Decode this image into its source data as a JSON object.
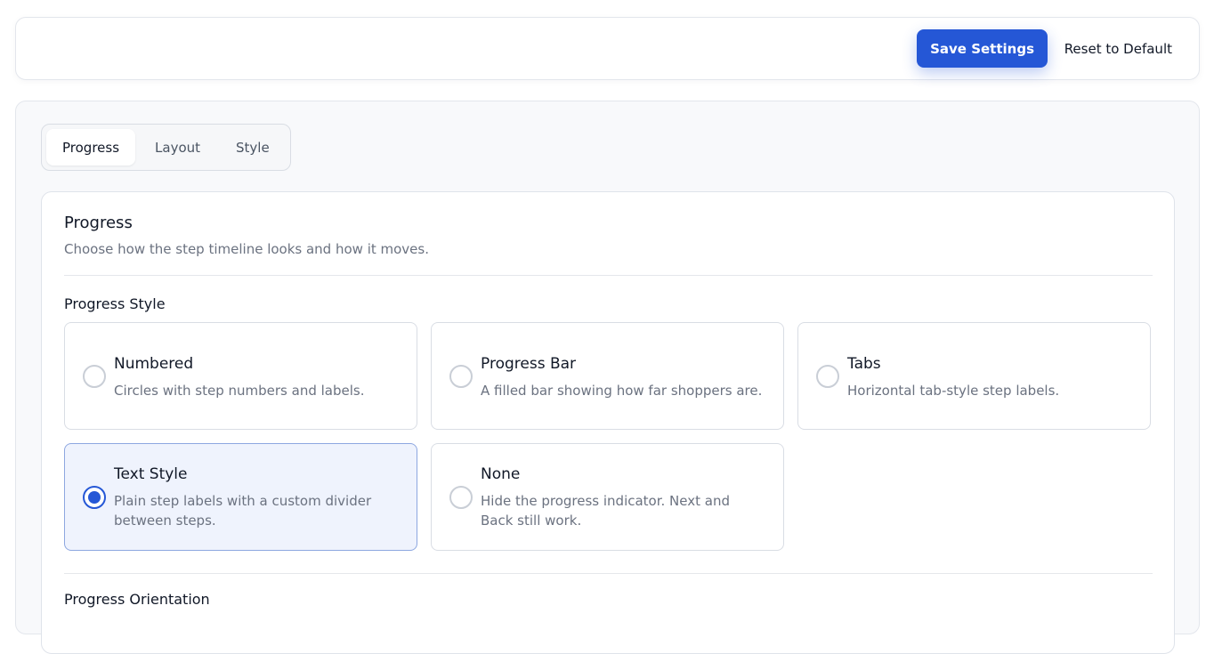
{
  "toolbar": {
    "save_label": "Save Settings",
    "reset_label": "Reset to Default"
  },
  "tabs": [
    {
      "label": "Progress",
      "active": true
    },
    {
      "label": "Layout",
      "active": false
    },
    {
      "label": "Style",
      "active": false
    }
  ],
  "progress": {
    "title": "Progress",
    "description": "Choose how the step timeline looks and how it moves.",
    "style_label": "Progress Style",
    "orientation_label": "Progress Orientation",
    "options": [
      {
        "title": "Numbered",
        "description": "Circles with step numbers and labels.",
        "selected": false
      },
      {
        "title": "Progress Bar",
        "description": "A filled bar showing how far shoppers are.",
        "selected": false
      },
      {
        "title": "Tabs",
        "description": "Horizontal tab-style step labels.",
        "selected": false
      },
      {
        "title": "Text Style",
        "description": "Plain step labels with a custom divider between steps.",
        "selected": true
      },
      {
        "title": "None",
        "description": "Hide the progress indicator. Next and Back still work.",
        "selected": false
      }
    ]
  },
  "colors": {
    "accent": "#2557d6",
    "selected_bg": "#eff3fd"
  }
}
